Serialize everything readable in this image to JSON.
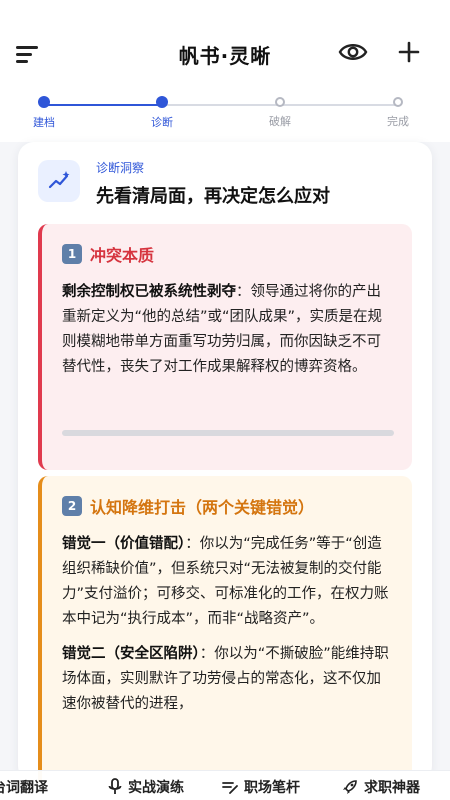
{
  "header": {
    "title": "帆书·灵晰",
    "icons": {
      "menu": "menu-icon",
      "eye": "eye-icon",
      "add": "plus-icon"
    }
  },
  "stepper": {
    "steps": [
      {
        "label": "建档",
        "state": "done"
      },
      {
        "label": "诊断",
        "state": "active"
      },
      {
        "label": "破解",
        "state": "pending"
      },
      {
        "label": "完成",
        "state": "pending"
      }
    ],
    "active_color": "#2f56d8"
  },
  "card": {
    "subtitle": "诊断洞察",
    "title": "先看清局面，再决定怎么应对",
    "icon": "trend-sparkle-icon"
  },
  "section1": {
    "number": "1",
    "title": "冲突本质",
    "lead": "剩余控制权已被系统性剥夺",
    "text": "：领导通过将你的产出重新定义为“他的总结”或“团队成果”，实质是在规则模糊地带单方面重写功劳归属，而你因缺乏不可替代性，丧失了对工作成果解释权的博弈资格。",
    "accent": "#e03a4e"
  },
  "section2": {
    "number": "2",
    "title": "认知降维打击（两个关键错觉）",
    "p1_lead": "错觉一（价值错配）",
    "p1_text": "：你以为“完成任务”等于“创造组织稀缺价值”，但系统只对“无法被复制的交付能力”支付溢价；可移交、可标准化的工作，在权力账本中记为“执行成本”，而非“战略资产”。",
    "p2_lead": "错觉二（安全区陷阱）",
    "p2_text": "：你以为“不撕破脸”能维持职场体面，实则默许了功劳侵占的常态化，这不仅加速你被替代的进程，",
    "accent": "#e58d1b"
  },
  "bottom_nav": [
    {
      "label": "台词翻译",
      "icon": "translate-icon"
    },
    {
      "label": "实战演练",
      "icon": "microphone-icon"
    },
    {
      "label": "职场笔杆",
      "icon": "pen-lines-icon"
    },
    {
      "label": "求职神器",
      "icon": "rocket-icon"
    }
  ]
}
